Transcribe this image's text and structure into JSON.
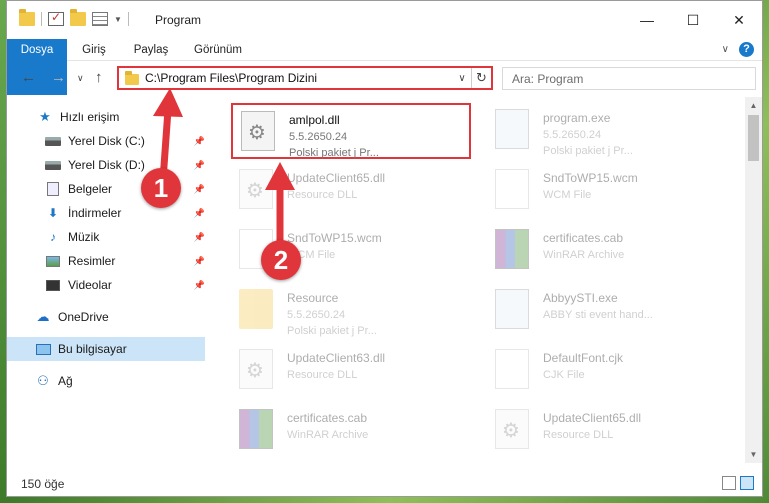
{
  "window": {
    "title": "Program"
  },
  "ribbon": {
    "tabs": [
      "Dosya",
      "Giriş",
      "Paylaş",
      "Görünüm"
    ]
  },
  "address": {
    "path": "C:\\Program Files\\Program Dizini",
    "search_placeholder": "Ara: Program"
  },
  "sidebar": {
    "items": [
      {
        "label": "Hızlı erişim",
        "icon": "star-icon"
      },
      {
        "label": "Yerel Disk (C:)",
        "icon": "disk-icon",
        "pinned": true
      },
      {
        "label": "Yerel Disk (D:)",
        "icon": "disk-icon",
        "pinned": true
      },
      {
        "label": "Belgeler",
        "icon": "document-icon",
        "pinned": true
      },
      {
        "label": "İndirmeler",
        "icon": "download-icon",
        "pinned": true
      },
      {
        "label": "Müzik",
        "icon": "music-icon",
        "pinned": true
      },
      {
        "label": "Resimler",
        "icon": "pictures-icon",
        "pinned": true
      },
      {
        "label": "Videolar",
        "icon": "videos-icon",
        "pinned": true
      },
      {
        "label": "OneDrive",
        "icon": "cloud-icon"
      },
      {
        "label": "Bu bilgisayar",
        "icon": "computer-icon",
        "selected": true
      },
      {
        "label": "Ağ",
        "icon": "network-icon"
      }
    ]
  },
  "files": [
    {
      "name": "amlpol.dll",
      "line1": "5.5.2650.24",
      "line2": "Polski pakiet j   Pr...",
      "icon": "dll-icon",
      "highlighted": true
    },
    {
      "name": "program.exe",
      "line1": "5.5.2650.24",
      "line2": "Polski pakiet j   Pr...",
      "icon": "exe-icon"
    },
    {
      "name": "UpdateClient65.dll",
      "line1": "Resource DLL",
      "line2": "",
      "icon": "dll-icon"
    },
    {
      "name": "SndToWP15.wcm",
      "line1": "WCM File",
      "line2": "",
      "icon": "document-icon"
    },
    {
      "name": "SndToWP15.wcm",
      "line1": "WCM File",
      "line2": "",
      "icon": "document-icon"
    },
    {
      "name": "certificates.cab",
      "line1": "WinRAR Archive",
      "line2": "",
      "icon": "archive-icon"
    },
    {
      "name": "Resource",
      "line1": "5.5.2650.24",
      "line2": "Polski pakiet j   Pr...",
      "icon": "folder-icon"
    },
    {
      "name": "AbbyySTI.exe",
      "line1": "ABBY sti event hand...",
      "line2": "",
      "icon": "exe-icon"
    },
    {
      "name": "UpdateClient63.dll",
      "line1": "Resource DLL",
      "line2": "",
      "icon": "dll-icon"
    },
    {
      "name": "DefaultFont.cjk",
      "line1": "CJK File",
      "line2": "",
      "icon": "document-icon"
    },
    {
      "name": "certificates.cab",
      "line1": "WinRAR Archive",
      "line2": "",
      "icon": "archive-icon"
    },
    {
      "name": "UpdateClient65.dll",
      "line1": "Resource DLL",
      "line2": "",
      "icon": "dll-icon"
    }
  ],
  "status": {
    "count": "150 öğe"
  },
  "annotations": {
    "step1": "1",
    "step2": "2",
    "color": "#e0353a"
  }
}
